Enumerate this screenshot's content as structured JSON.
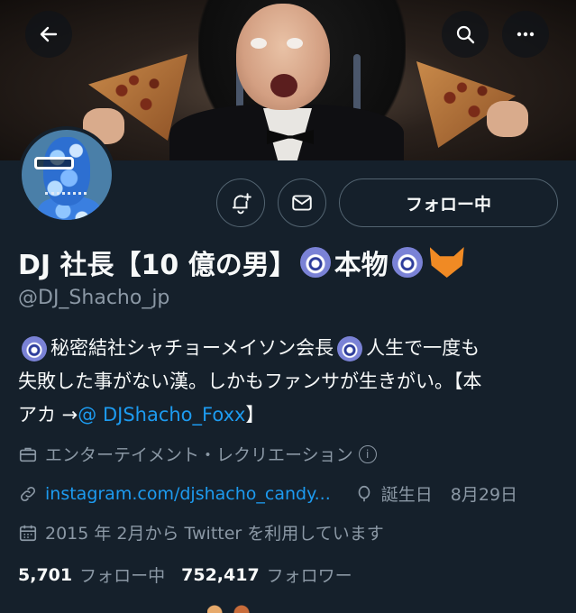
{
  "header": {
    "back_icon": "arrow-left-icon",
    "search_icon": "search-icon",
    "more_icon": "more-horizontal-icon"
  },
  "actions": {
    "notify_icon": "bell-plus-icon",
    "message_icon": "envelope-icon",
    "following_label": "フォロー中"
  },
  "profile": {
    "name_part1": "DJ 社長【10 億の男】",
    "name_part2": "本物",
    "handle": "@DJ_Shacho_jp"
  },
  "bio": {
    "line1_a": "秘密結社シャチョーメイソン会長",
    "line1_b": "人生で一度も",
    "line2": "失敗した事がない漢。しかもファンサが生きがい。【本",
    "line3_a": "アカ → ",
    "line3_link": "@ DJShacho_Foxx",
    "line3_b": "】"
  },
  "meta": {
    "category": "エンターテイメント・レクリエーション",
    "url": "instagram.com/djshacho_candy...",
    "birthday_label": "誕生日",
    "birthday_value": "8月29日",
    "joined": "2015 年 2月から Twitter を利用しています"
  },
  "stats": {
    "following_count": "5,701",
    "following_label": "フォロー中",
    "followers_count": "752,417",
    "followers_label": "フォロワー"
  },
  "colors": {
    "background": "#15202b",
    "text": "#f7f9f9",
    "muted": "#8b98a5",
    "link": "#1d9bf0",
    "border": "#536471"
  }
}
